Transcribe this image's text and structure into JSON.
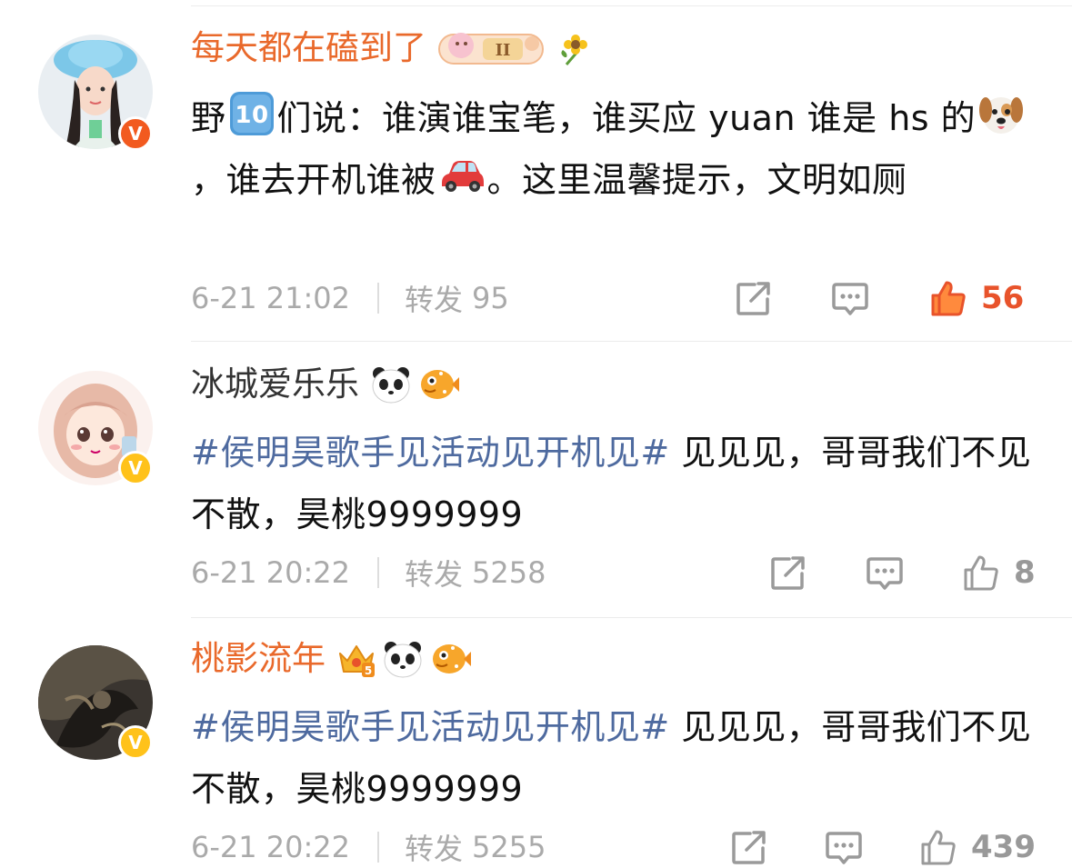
{
  "comments": [
    {
      "username": "每天都在磕到了",
      "username_color": "#e9692b",
      "verified": "red",
      "badges": [
        "fan-club-badge-icon",
        "sunflower-icon"
      ],
      "content_parts": [
        {
          "type": "text",
          "text": "野"
        },
        {
          "type": "emoji",
          "name": "keycap-ten-icon"
        },
        {
          "type": "text",
          "text": "们说：谁演谁宝笔，谁买应 yuan 谁是 hs 的"
        },
        {
          "type": "emoji",
          "name": "dog-face-icon"
        },
        {
          "type": "text",
          "text": "，谁去开机谁被"
        },
        {
          "type": "emoji",
          "name": "red-car-icon"
        },
        {
          "type": "text",
          "text": "。这里温馨提示，文明如厕"
        }
      ],
      "time": "6-21 21:02",
      "repost_label": "转发",
      "repost_count": "95",
      "likes": "56",
      "liked": true
    },
    {
      "username": "冰城爱乐乐",
      "username_color": "#333333",
      "verified": "yellow",
      "badges": [
        "panda-icon",
        "pufferfish-icon"
      ],
      "hashtag": "#侯明昊歌手见活动见开机见#",
      "text": " 见见见，哥哥我们不见不散，昊桃9999999",
      "time": "6-21 20:22",
      "repost_label": "转发",
      "repost_count": "5258",
      "likes": "8",
      "liked": false
    },
    {
      "username": "桃影流年",
      "username_color": "#e9692b",
      "verified": "yellow",
      "badges": [
        "crown-level-5-icon",
        "panda-icon",
        "pufferfish-icon"
      ],
      "hashtag": "#侯明昊歌手见活动见开机见#",
      "text": " 见见见，哥哥我们不见不散，昊桃9999999",
      "time": "6-21 20:22",
      "repost_label": "转发",
      "repost_count": "5255",
      "likes": "439",
      "liked": false
    }
  ]
}
